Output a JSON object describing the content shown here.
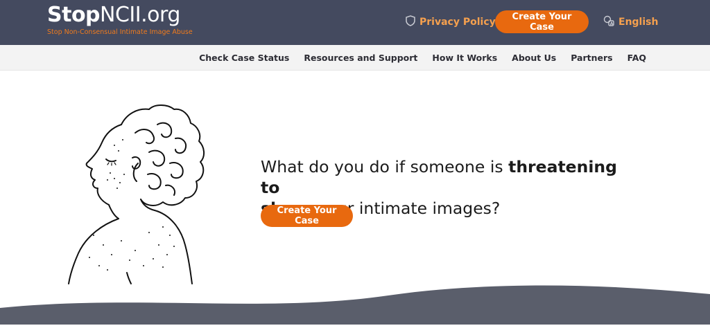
{
  "header": {
    "logo_bold": "Stop",
    "logo_rest": "NCII.org",
    "tagline": "Stop Non-Consensual Intimate Image Abuse",
    "privacy_label": "Privacy Policy",
    "cta_label": "Create Your Case",
    "language": "English"
  },
  "nav": {
    "items": [
      "Check Case Status",
      "Resources and Support",
      "How It Works",
      "About Us",
      "Partners",
      "FAQ"
    ]
  },
  "hero": {
    "headline_start": "What do you do if someone is ",
    "headline_bold1": "threatening to",
    "headline_bold2": "share",
    "headline_end": " your intimate images?",
    "cta_label": "Create Your Case"
  },
  "colors": {
    "header_bg": "#444a5f",
    "accent": "#e8690f",
    "footer_wave": "#5a5e6b"
  }
}
